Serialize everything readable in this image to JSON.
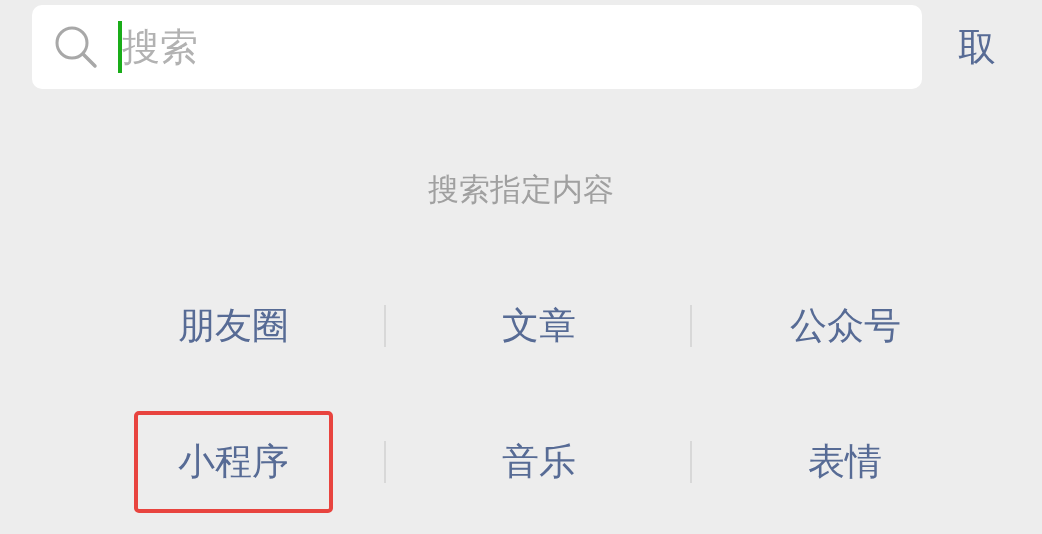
{
  "search": {
    "placeholder": "搜索",
    "focused": true
  },
  "cancel": "取",
  "section_title": "搜索指定内容",
  "options": [
    {
      "label": "朋友圈",
      "highlighted": false
    },
    {
      "label": "文章",
      "highlighted": false
    },
    {
      "label": "公众号",
      "highlighted": false
    },
    {
      "label": "小程序",
      "highlighted": true
    },
    {
      "label": "音乐",
      "highlighted": false
    },
    {
      "label": "表情",
      "highlighted": false
    }
  ]
}
